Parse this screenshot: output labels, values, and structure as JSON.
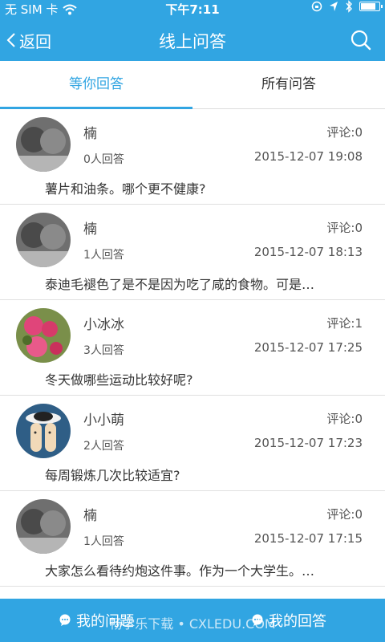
{
  "status_bar": {
    "carrier": "无 SIM 卡",
    "time": "下午7:11",
    "battery_level": 0.85
  },
  "header": {
    "back_label": "返回",
    "title": "线上问答"
  },
  "tabs": [
    {
      "label": "等你回答",
      "active": true
    },
    {
      "label": "所有问答",
      "active": false
    }
  ],
  "questions": [
    {
      "name": "楠",
      "answers": "0人回答",
      "comments": "评论:0",
      "time": "2015-12-07 19:08",
      "question": "薯片和油条。哪个更不健康?"
    },
    {
      "name": "楠",
      "answers": "1人回答",
      "comments": "评论:0",
      "time": "2015-12-07 18:13",
      "question": "泰迪毛褪色了是不是因为吃了咸的食物。可是…"
    },
    {
      "name": "小冰冰",
      "answers": "3人回答",
      "comments": "评论:1",
      "time": "2015-12-07 17:25",
      "question": "冬天做哪些运动比较好呢?"
    },
    {
      "name": "小小萌",
      "answers": "2人回答",
      "comments": "评论:0",
      "time": "2015-12-07 17:23",
      "question": "每周锻炼几次比较适宜?"
    },
    {
      "name": "楠",
      "answers": "1人回答",
      "comments": "评论:0",
      "time": "2015-12-07 17:15",
      "question": "大家怎么看待约炮这件事。作为一个大学生。…"
    }
  ],
  "bottom_bar": {
    "my_questions": "我的问题",
    "my_answers": "我的回答",
    "watermark": "畅学乐下载 • CXLEDU.COM"
  },
  "colors": {
    "accent": "#31a5e2"
  }
}
